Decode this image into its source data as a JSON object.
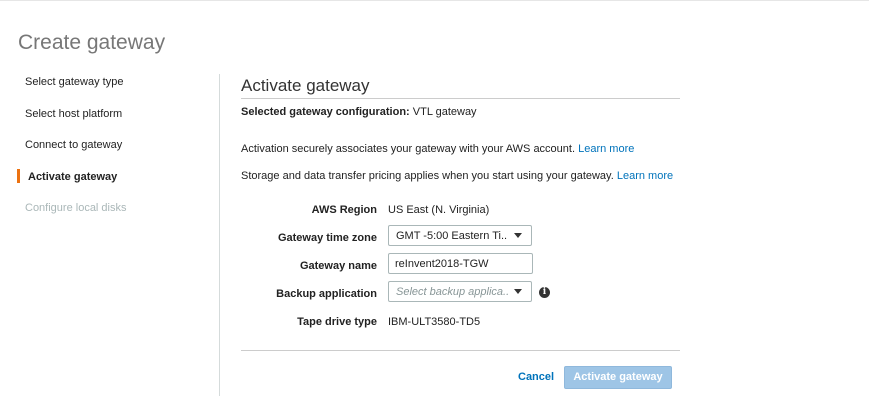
{
  "page_title": "Create gateway",
  "steps": [
    {
      "label": "Select gateway type",
      "state": "complete"
    },
    {
      "label": "Select host platform",
      "state": "complete"
    },
    {
      "label": "Connect to gateway",
      "state": "complete"
    },
    {
      "label": "Activate gateway",
      "state": "active"
    },
    {
      "label": "Configure local disks",
      "state": "disabled"
    }
  ],
  "main": {
    "title": "Activate gateway",
    "config_label": "Selected gateway configuration:",
    "config_value": "VTL gateway",
    "activation_text": "Activation securely associates your gateway with your AWS account.",
    "activation_link": "Learn more",
    "pricing_text": "Storage and data transfer pricing applies when you start using your gateway.",
    "pricing_link": "Learn more"
  },
  "form": {
    "region_label": "AWS Region",
    "region_value": "US East (N. Virginia)",
    "timezone_label": "Gateway time zone",
    "timezone_value": "GMT -5:00 Eastern Ti...",
    "name_label": "Gateway name",
    "name_value": "reInvent2018-TGW",
    "backup_label": "Backup application",
    "backup_placeholder": "Select backup applica...",
    "tape_label": "Tape drive type",
    "tape_value": "IBM-ULT3580-TD5"
  },
  "actions": {
    "cancel_label": "Cancel",
    "activate_label": "Activate gateway"
  },
  "colors": {
    "accent": "#ec7211",
    "link": "#0073bb",
    "primary_disabled": "#9ec5e6"
  },
  "icons": {
    "info": "info-icon",
    "dropdown": "chevron-down-icon"
  }
}
